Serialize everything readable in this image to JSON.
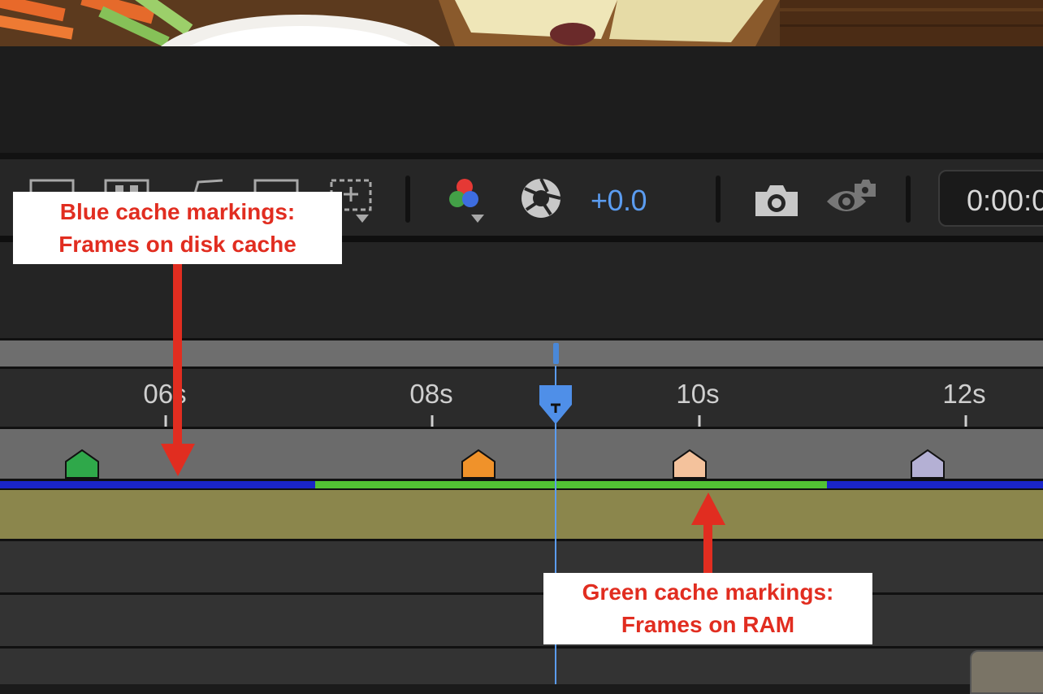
{
  "toolbar": {
    "exposure_value": "+0.0",
    "timecode": "0:00:0"
  },
  "ruler": {
    "ticks": [
      {
        "label": "06s"
      },
      {
        "label": "08s"
      },
      {
        "label": "10s"
      },
      {
        "label": "12s"
      }
    ]
  },
  "markers": [
    {
      "color": "#2fa84a"
    },
    {
      "color": "#f0922a"
    },
    {
      "color": "#f4c29c"
    },
    {
      "color": "#b4b0d4"
    }
  ],
  "cache": {
    "disk_color": "#1a25c8",
    "ram_color": "#52c234"
  },
  "annotations": {
    "blue": {
      "line1": "Blue cache markings:",
      "line2": "Frames on disk cache"
    },
    "green": {
      "line1": "Green cache markings:",
      "line2": "Frames on RAM"
    }
  }
}
